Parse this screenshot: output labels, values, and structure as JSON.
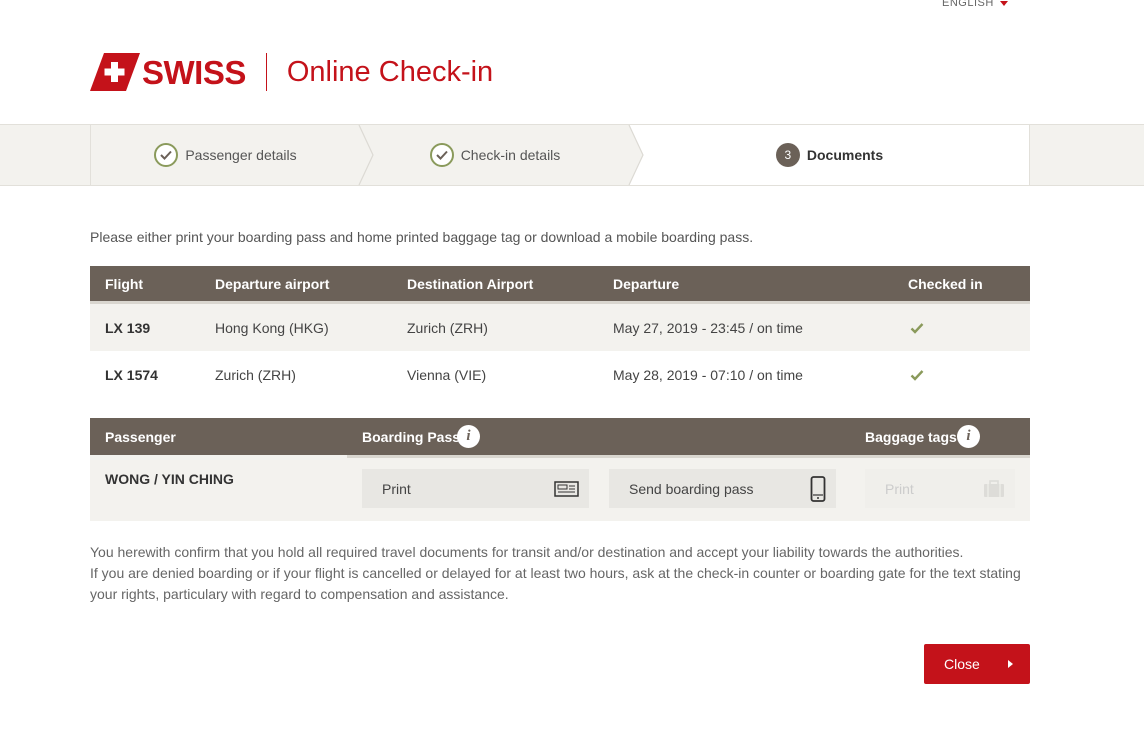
{
  "language": {
    "label": "ENGLISH"
  },
  "header": {
    "brand": "SWISS",
    "title": "Online Check-in"
  },
  "steps": [
    {
      "label": "Passenger details",
      "status": "done"
    },
    {
      "label": "Check-in details",
      "status": "done"
    },
    {
      "number": "3",
      "label": "Documents",
      "status": "active"
    }
  ],
  "intro": "Please either print your boarding pass and home printed baggage tag or download a mobile boarding pass.",
  "flights": {
    "columns": [
      "Flight",
      "Departure airport",
      "Destination Airport",
      "Departure",
      "Checked in"
    ],
    "rows": [
      {
        "flight": "LX 139",
        "from": "Hong Kong (HKG)",
        "to": "Zurich (ZRH)",
        "departure": "May 27, 2019 - 23:45 / on time",
        "checked_in": true
      },
      {
        "flight": "LX 1574",
        "from": "Zurich (ZRH)",
        "to": "Vienna (VIE)",
        "departure": "May 28, 2019 - 07:10 / on time",
        "checked_in": true
      }
    ]
  },
  "passengers": {
    "columns": {
      "passenger": "Passenger",
      "boarding_pass": "Boarding Pass",
      "baggage_tags": "Baggage tags"
    },
    "rows": [
      {
        "name": "WONG / YIN CHING",
        "print_label": "Print",
        "send_label": "Send boarding pass",
        "baggage_print_label": "Print"
      }
    ]
  },
  "disclaimer": {
    "line1": "You herewith confirm that you hold all required travel documents for transit and/or destination and accept your liability towards the authorities.",
    "line2": "If you are denied boarding or if your flight is cancelled or delayed for at least two hours, ask at the check-in counter or boarding gate for the text stating your rights, particulary with regard to compensation and assistance."
  },
  "close_label": "Close",
  "colors": {
    "brand_red": "#c4121a",
    "header_brown": "#6b6158",
    "check_green": "#8a9a5b",
    "row_bg": "#f3f2ee"
  }
}
